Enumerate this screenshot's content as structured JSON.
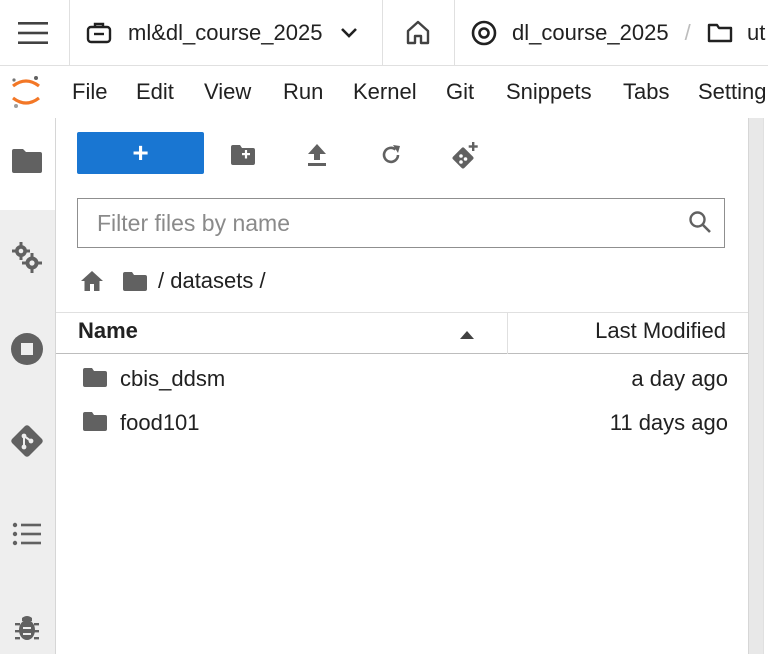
{
  "topbar": {
    "workspace": "ml&dl_course_2025",
    "project": "dl_course_2025",
    "path_partial": "ut"
  },
  "menu": [
    "File",
    "Edit",
    "View",
    "Run",
    "Kernel",
    "Git",
    "Snippets",
    "Tabs",
    "Setting"
  ],
  "filebrowser": {
    "new_label": "+",
    "filter_placeholder": "Filter files by name",
    "breadcrumb": "/ datasets /",
    "columns": {
      "name": "Name",
      "modified": "Last Modified"
    },
    "files": [
      {
        "name": "cbis_ddsm",
        "modified": "a day ago",
        "type": "folder"
      },
      {
        "name": "food101",
        "modified": "11 days ago",
        "type": "folder"
      }
    ]
  },
  "colors": {
    "accent": "#1976d2",
    "logo": "#f37726"
  }
}
